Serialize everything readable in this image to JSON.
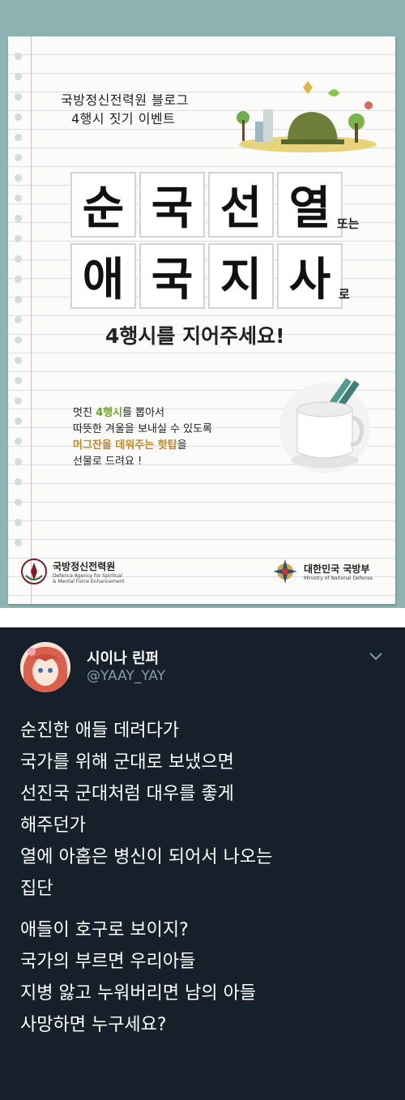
{
  "poster": {
    "handwriting_line1": "국방정신전력원 블로그",
    "handwriting_line2": "4행시 짓기 이벤트",
    "row1_chars": [
      "순",
      "국",
      "선",
      "열"
    ],
    "row1_suffix": "또는",
    "row2_chars": [
      "애",
      "국",
      "지",
      "사"
    ],
    "row2_suffix": "로",
    "subline": "4행시를 지어주세요!",
    "prize": {
      "l1_a": "멋진 ",
      "l1_hl": "4행시",
      "l1_b": "를 뽑아서",
      "l2": "따뜻한 겨울을 보내실 수 있도록",
      "l3_hl": "머그잔을 데워주는 핫탑",
      "l3_b": "을",
      "l4": "선물로 드려요 !"
    },
    "org_left_kr": "국방정신전력원",
    "org_left_en1": "Defence Agency for Spiritual",
    "org_left_en2": "& Mental Force Enhancement",
    "org_right_kr": "대한민국 국방부",
    "org_right_en": "Ministry of National Defense"
  },
  "tweet": {
    "display_name": "시이나 린퍼",
    "handle": "@YAAY_YAY",
    "para1": [
      "순진한 애들 데려다가",
      "국가를 위해 군대로 보냈으면",
      "선진국 군대처럼 대우를 좋게",
      "해주던가",
      "열에 아홉은 병신이 되어서 나오는",
      "집단"
    ],
    "para2": [
      "애들이 호구로 보이지?",
      "국가의 부르면 우리아들",
      "지병 앓고 누워버리면 남의 아들",
      "사망하면 누구세요?"
    ]
  },
  "colors": {
    "poster_bg": "#8fb3b2",
    "tweet_bg": "#15202b",
    "handle_gray": "#8899a6",
    "highlight_green": "#6aa524",
    "highlight_orange": "#c8871c"
  }
}
